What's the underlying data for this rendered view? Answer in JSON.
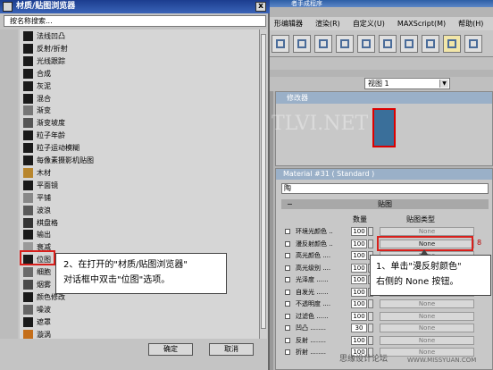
{
  "app": {
    "title_fragment": "者手成程序"
  },
  "menubar": {
    "items": [
      "形编辑器",
      "渲染(R)",
      "自定义(U)",
      "MAXScript(M)",
      "帮助(H)"
    ]
  },
  "viewport": {
    "selected_view": "视图 1"
  },
  "stack_panel": {
    "header": "修改器"
  },
  "watermark": {
    "text": "騰龍視覺 WWW.TLVI.NET"
  },
  "material_panel": {
    "header": "Material #31  ( Standard )",
    "name_field": "陶",
    "maps_rollout": "贴图",
    "col_amount": "数量",
    "col_type": "贴图类型",
    "rows": [
      {
        "label": "环境光颜色 ..",
        "amount": "100",
        "map": "None"
      },
      {
        "label": "漫反射颜色 ..",
        "amount": "100",
        "map": "None"
      },
      {
        "label": "高光颜色 ....",
        "amount": "100",
        "map": "None"
      },
      {
        "label": "高光级别 ....",
        "amount": "100",
        "map": "None"
      },
      {
        "label": "光泽度 ......",
        "amount": "100",
        "map": "None"
      },
      {
        "label": "自发光 ......",
        "amount": "100",
        "map": "None"
      },
      {
        "label": "不透明度 ....",
        "amount": "100",
        "map": "None"
      },
      {
        "label": "过滤色 ......",
        "amount": "100",
        "map": "None"
      },
      {
        "label": "凹凸 ........",
        "amount": "30",
        "map": "None"
      },
      {
        "label": "反射 ........",
        "amount": "100",
        "map": "None"
      },
      {
        "label": "折射 ........",
        "amount": "100",
        "map": "None"
      }
    ],
    "lock_icon_text": "8"
  },
  "callout_right": {
    "line1": "1、单击\"漫反射颜色\"",
    "line2": "右侧的 None 按钮。"
  },
  "browser": {
    "title": "材质/贴图浏览器",
    "close_label": "x",
    "search_placeholder": "按名称搜索...",
    "entries": [
      {
        "name": "法线凹凸",
        "swatch": "#1a1a1a"
      },
      {
        "name": "反射/折射",
        "swatch": "#1a1a1a"
      },
      {
        "name": "光线跟踪",
        "swatch": "#1a1a1a"
      },
      {
        "name": "合成",
        "swatch": "#1a1a1a"
      },
      {
        "name": "灰泥",
        "swatch": "#1a1a1a"
      },
      {
        "name": "混合",
        "swatch": "#1a1a1a"
      },
      {
        "name": "渐变",
        "swatch": "#777777"
      },
      {
        "name": "渐变坡度",
        "swatch": "#555555"
      },
      {
        "name": "粒子年龄",
        "swatch": "#1a1a1a"
      },
      {
        "name": "粒子运动模糊",
        "swatch": "#1a1a1a"
      },
      {
        "name": "每像素摄影机贴图",
        "swatch": "#1a1a1a"
      },
      {
        "name": "木材",
        "swatch": "#b8862e"
      },
      {
        "name": "平面镜",
        "swatch": "#1a1a1a"
      },
      {
        "name": "平铺",
        "swatch": "#888888"
      },
      {
        "name": "波浪",
        "swatch": "#5a5a5a"
      },
      {
        "name": "棋盘格",
        "swatch": "#333333"
      },
      {
        "name": "输出",
        "swatch": "#1a1a1a"
      },
      {
        "name": "衰减",
        "swatch": "#9a9a9a"
      },
      {
        "name": "位图",
        "swatch": "#1a1a1a"
      },
      {
        "name": "细胞",
        "swatch": "#6a6a6a"
      },
      {
        "name": "烟雾",
        "swatch": "#4a4a4a"
      },
      {
        "name": "颜色修改",
        "swatch": "#1a1a1a"
      },
      {
        "name": "噪波",
        "swatch": "#666666"
      },
      {
        "name": "遮罩",
        "swatch": "#1a1a1a"
      },
      {
        "name": "漩涡",
        "swatch": "#c46e1a"
      }
    ],
    "ok_label": "确定",
    "cancel_label": "取消"
  },
  "callout_left": {
    "line1": "2、在打开的\"材质/贴图浏览器\"",
    "line2": "对话框中双击\"位图\"选项。"
  },
  "footer": {
    "text": "思缘设计论坛",
    "url": "WWW.MISSYUAN.COM"
  }
}
